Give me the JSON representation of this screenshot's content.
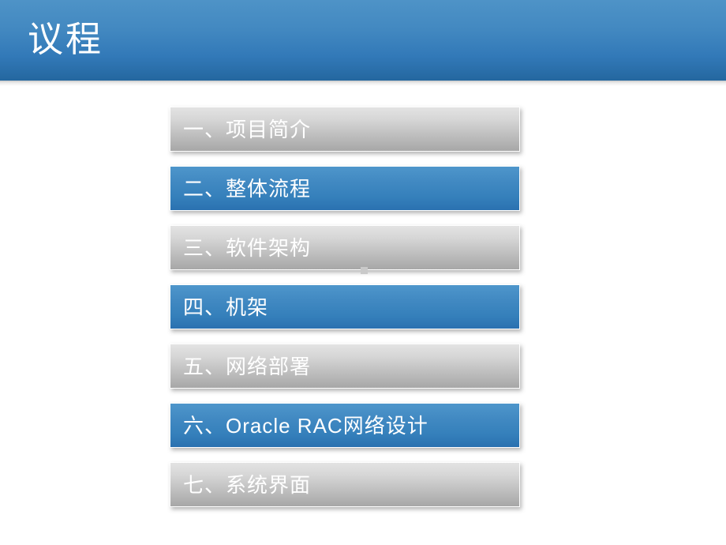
{
  "slide": {
    "background_color": "#ffffff",
    "header": {
      "title": "议程",
      "gradient_top": "#4e93c7",
      "gradient_bottom": "#24679f",
      "title_color": "#ffffff"
    },
    "agenda": {
      "gray_gradient_top": "#e3e3e3",
      "gray_gradient_bottom": "#a7a7a7",
      "blue_gradient_top": "#4e96cb",
      "blue_gradient_bottom": "#2a71b0",
      "label_color": "#ffffff",
      "items": [
        {
          "label": "一、项目简介",
          "style": "gray"
        },
        {
          "label": "二、整体流程",
          "style": "blue"
        },
        {
          "label": "三、软件架构",
          "style": "gray"
        },
        {
          "label": "四、机架",
          "style": "blue"
        },
        {
          "label": "五、网络部署",
          "style": "gray"
        },
        {
          "label": "六、Oracle RAC网络设计",
          "style": "blue"
        },
        {
          "label": "七、系统界面",
          "style": "gray"
        }
      ]
    }
  }
}
